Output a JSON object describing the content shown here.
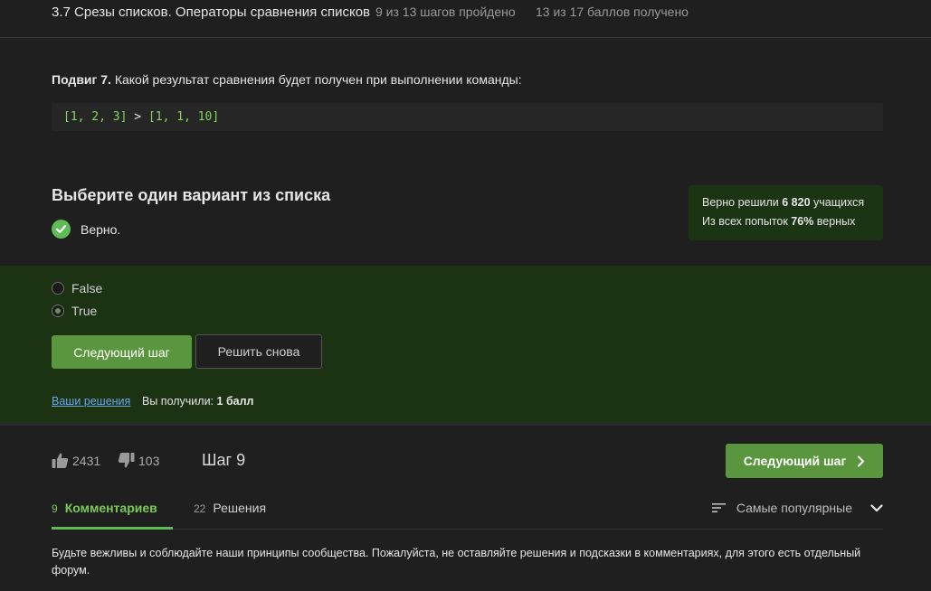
{
  "header": {
    "lesson_title": "3.7 Срезы списков. Операторы сравнения списков",
    "steps_progress": "9 из 13 шагов пройдено",
    "points_progress": "13 из 17 баллов  получено"
  },
  "question": {
    "prefix": "Подвиг 7.",
    "text": " Какой результат сравнения будет получен при выполнении команды:",
    "code_left": "[1, 2, 3]",
    "code_op": " > ",
    "code_right": "[1, 1, 10]"
  },
  "quiz": {
    "title": "Выберите один вариант из списка",
    "status": "Верно.",
    "options": [
      {
        "label": "False",
        "selected": false
      },
      {
        "label": "True",
        "selected": true
      }
    ],
    "next_button": "Следующий шаг",
    "retry_button": "Решить снова",
    "your_solutions_link": "Ваши решения",
    "received_prefix": "Вы получили: ",
    "received_value": "1 балл"
  },
  "stats": {
    "solved_prefix": "Верно решили ",
    "solved_count": "6 820",
    "solved_suffix": " учащихся",
    "attempts_prefix": "Из всех попыток ",
    "attempts_percent": "76%",
    "attempts_suffix": " верных"
  },
  "footer": {
    "likes": "2431",
    "dislikes": "103",
    "step_label": "Шаг 9",
    "next_step_button": "Следующий шаг"
  },
  "tabs": [
    {
      "count": "9",
      "label": "Комментариев",
      "active": true
    },
    {
      "count": "22",
      "label": "Решения",
      "active": false
    }
  ],
  "sort": {
    "label": "Самые популярные"
  },
  "notice": "Будьте вежливы и соблюдайте наши принципы сообщества. Пожалуйста, не оставляйте решения и подсказки в комментариях, для этого есть отдельный форум.",
  "colors": {
    "accent_green": "#5a963d",
    "correct_green": "#5fbb55",
    "answer_bg": "#1b3213",
    "link_blue": "#68a8e8"
  },
  "icons": [
    "check-circle-icon",
    "thumbs-up-icon",
    "thumbs-down-icon",
    "chevron-right-icon",
    "sort-lines-icon",
    "chevron-down-icon"
  ]
}
